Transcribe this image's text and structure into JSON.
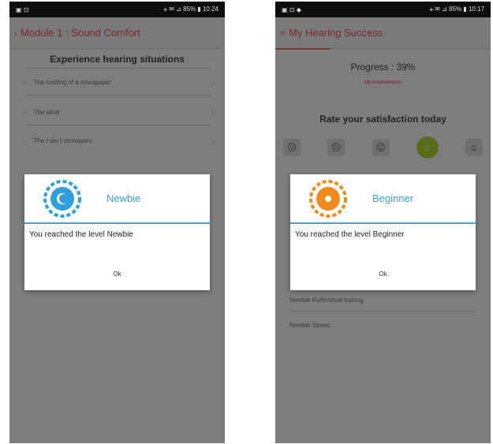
{
  "left_screen": {
    "status_left": "▣ ⊡",
    "status_right": "⚹ ✉ ⊿ 85% ▮ 10:24",
    "app_title": "Module 1 : Sound Comfort",
    "section_title": "Experience hearing situations",
    "list_items": [
      "The rustling of a newspaper",
      "The wind",
      "The r ain t umnaaarn"
    ],
    "dialog": {
      "title": "Newbie",
      "message": "You reached the level Newbie",
      "button": "Ok",
      "badge_color": "#2f9fdc"
    }
  },
  "right_screen": {
    "status_left": "▣ ⊡ ◆",
    "status_right": "⚹ ✉ ⊿ 85% ▮ 10:17",
    "app_title": "My Hearing Success",
    "progress_text": "Progress : 39%",
    "progress_link": "My Achievements",
    "rate_title": "Rate your satisfaction today",
    "faces": [
      "very-unhappy-face",
      "unhappy-face",
      "neutral-face",
      "happy-face",
      "very-happy-face"
    ],
    "faces_glyphs": [
      "☹",
      "☹",
      "😐",
      "☺",
      "☺"
    ],
    "selected_face_index": 3,
    "list_items": [
      "Newbie  Ruftrvidual trainng",
      "Newbie  Speec"
    ],
    "dialog": {
      "title": "Beginner",
      "message": "You reached the level Beginner",
      "button": "Ok",
      "badge_color": "#f08a1c"
    }
  },
  "colors": {
    "accent": "#7a1722",
    "dialog_rule": "#3aa3d8",
    "overlay": "#7d7d7d"
  }
}
